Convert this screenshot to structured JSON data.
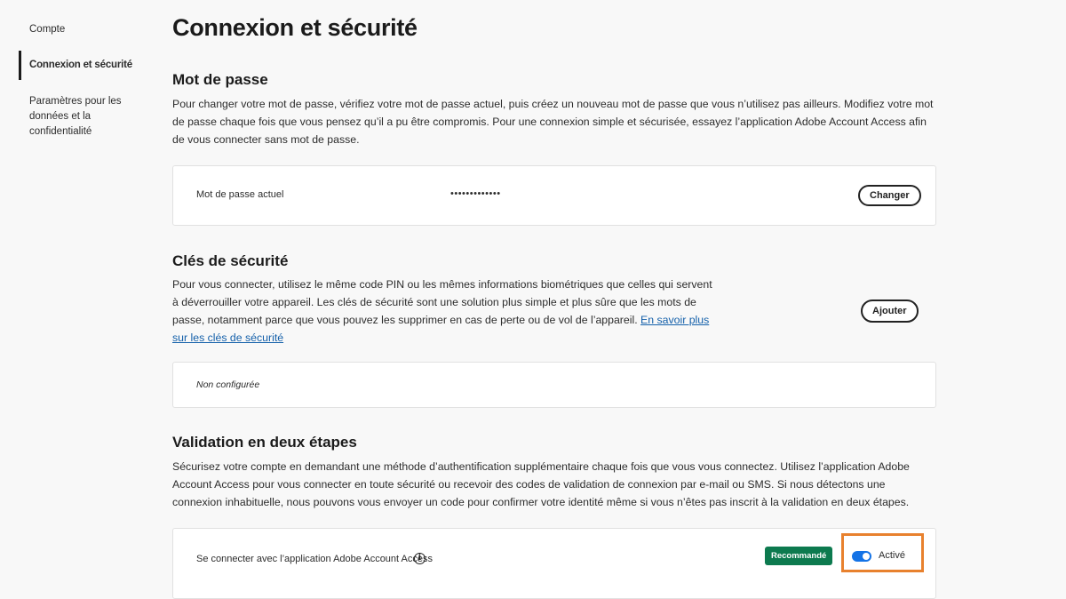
{
  "sidebar": {
    "items": [
      {
        "label": "Compte"
      },
      {
        "label": "Connexion et sécurité"
      },
      {
        "label": "Paramètres pour les données et la confidentialité"
      }
    ]
  },
  "page": {
    "title": "Connexion et sécurité"
  },
  "password": {
    "heading": "Mot de passe",
    "description": "Pour changer votre mot de passe, vérifiez votre mot de passe actuel, puis créez un nouveau mot de passe que vous n’utilisez pas ailleurs. Modifiez votre mot de passe chaque fois que vous pensez qu’il a pu être compromis. Pour une connexion simple et sécurisée, essayez l’application Adobe Account Access afin de vous connecter sans mot de passe.",
    "current_label": "Mot de passe actuel",
    "masked_value": "•••••••••••••",
    "change_button": "Changer"
  },
  "security_keys": {
    "heading": "Clés de sécurité",
    "description": "Pour vous connecter, utilisez le même code PIN ou les mêmes informations biométriques que celles qui servent à déverrouiller votre appareil. Les clés de sécurité sont une solution plus simple et plus sûre que les mots de passe, notamment parce que vous pouvez les supprimer en cas de perte ou de vol de l’appareil. ",
    "learn_more_link": "En savoir plus sur les clés de sécurité",
    "add_button": "Ajouter",
    "status": "Non configurée"
  },
  "two_step": {
    "heading": "Validation en deux étapes",
    "description": "Sécurisez votre compte en demandant une méthode d’authentification supplémentaire chaque fois que vous vous connectez. Utilisez l’application Adobe Account Access pour vous connecter en toute sécurité ou recevoir des codes de validation de connexion par e-mail ou SMS. Si nous détectons une connexion inhabituelle, nous pouvons vous envoyer un code pour confirmer votre identité même si vous n’êtes pas inscrit à la validation en deux étapes.",
    "app_option_label": "Se connecter avec l’application Adobe Account Access",
    "info_glyph": "i",
    "badge": "Recommandé",
    "toggle_label": "Activé",
    "toggle_on": true
  },
  "colors": {
    "badge_green": "#0d7a4f",
    "toggle_blue": "#1473e6",
    "highlight_orange": "#e8812e",
    "link_blue": "#1460aa"
  }
}
